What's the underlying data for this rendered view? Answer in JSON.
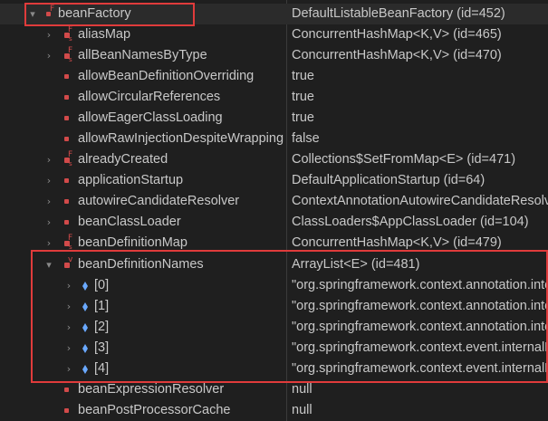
{
  "tree": {
    "rows": [
      {
        "name": "beanFactory",
        "value": "DefaultListableBeanFactory  (id=452)",
        "twisty": "down",
        "icon": "field-final"
      },
      {
        "name": "aliasMap",
        "value": "ConcurrentHashMap<K,V>  (id=465)",
        "twisty": "right",
        "icon": "field-final-static"
      },
      {
        "name": "allBeanNamesByType",
        "value": "ConcurrentHashMap<K,V>  (id=470)",
        "twisty": "right",
        "icon": "field-final-static"
      },
      {
        "name": "allowBeanDefinitionOverriding",
        "value": "true",
        "twisty": "",
        "icon": "private-field"
      },
      {
        "name": "allowCircularReferences",
        "value": "true",
        "twisty": "",
        "icon": "private-field"
      },
      {
        "name": "allowEagerClassLoading",
        "value": "true",
        "twisty": "",
        "icon": "private-field"
      },
      {
        "name": "allowRawInjectionDespiteWrapping",
        "value": "false",
        "twisty": "",
        "icon": "private-field"
      },
      {
        "name": "alreadyCreated",
        "value": "Collections$SetFromMap<E>  (id=471)",
        "twisty": "right",
        "icon": "field-final-static"
      },
      {
        "name": "applicationStartup",
        "value": "DefaultApplicationStartup  (id=64)",
        "twisty": "right",
        "icon": "private-field"
      },
      {
        "name": "autowireCandidateResolver",
        "value": "ContextAnnotationAutowireCandidateResolver",
        "twisty": "right",
        "icon": "private-field"
      },
      {
        "name": "beanClassLoader",
        "value": "ClassLoaders$AppClassLoader  (id=104)",
        "twisty": "right",
        "icon": "private-field"
      },
      {
        "name": "beanDefinitionMap",
        "value": "ConcurrentHashMap<K,V>  (id=479)",
        "twisty": "right",
        "icon": "field-final-static"
      },
      {
        "name": "beanDefinitionNames",
        "value": "ArrayList<E>  (id=481)",
        "twisty": "down",
        "icon": "field-volatile"
      },
      {
        "name": "[0]",
        "value": "\"org.springframework.context.annotation.internalConfigurationAnnotationProcessor\"",
        "twisty": "right",
        "icon": "array-element"
      },
      {
        "name": "[1]",
        "value": "\"org.springframework.context.annotation.internalAutowiredAnnotationProcessor\"",
        "twisty": "right",
        "icon": "array-element"
      },
      {
        "name": "[2]",
        "value": "\"org.springframework.context.annotation.internalCommonAnnotationProcessor\"",
        "twisty": "right",
        "icon": "array-element"
      },
      {
        "name": "[3]",
        "value": "\"org.springframework.context.event.internalEventListenerProcessor\"",
        "twisty": "right",
        "icon": "array-element"
      },
      {
        "name": "[4]",
        "value": "\"org.springframework.context.event.internalEventListenerFactory\"",
        "twisty": "right",
        "icon": "array-element"
      },
      {
        "name": "beanExpressionResolver",
        "value": "null",
        "twisty": "",
        "icon": "private-field"
      },
      {
        "name": "beanPostProcessorCache",
        "value": "null",
        "twisty": "",
        "icon": "private-field"
      }
    ]
  },
  "colors": {
    "background": "#1f1f1f",
    "text": "#c8c8c8",
    "twisty": "#8a8a8a",
    "field_dot": "#d24a4a",
    "annotation_box": "#e03b3b"
  }
}
